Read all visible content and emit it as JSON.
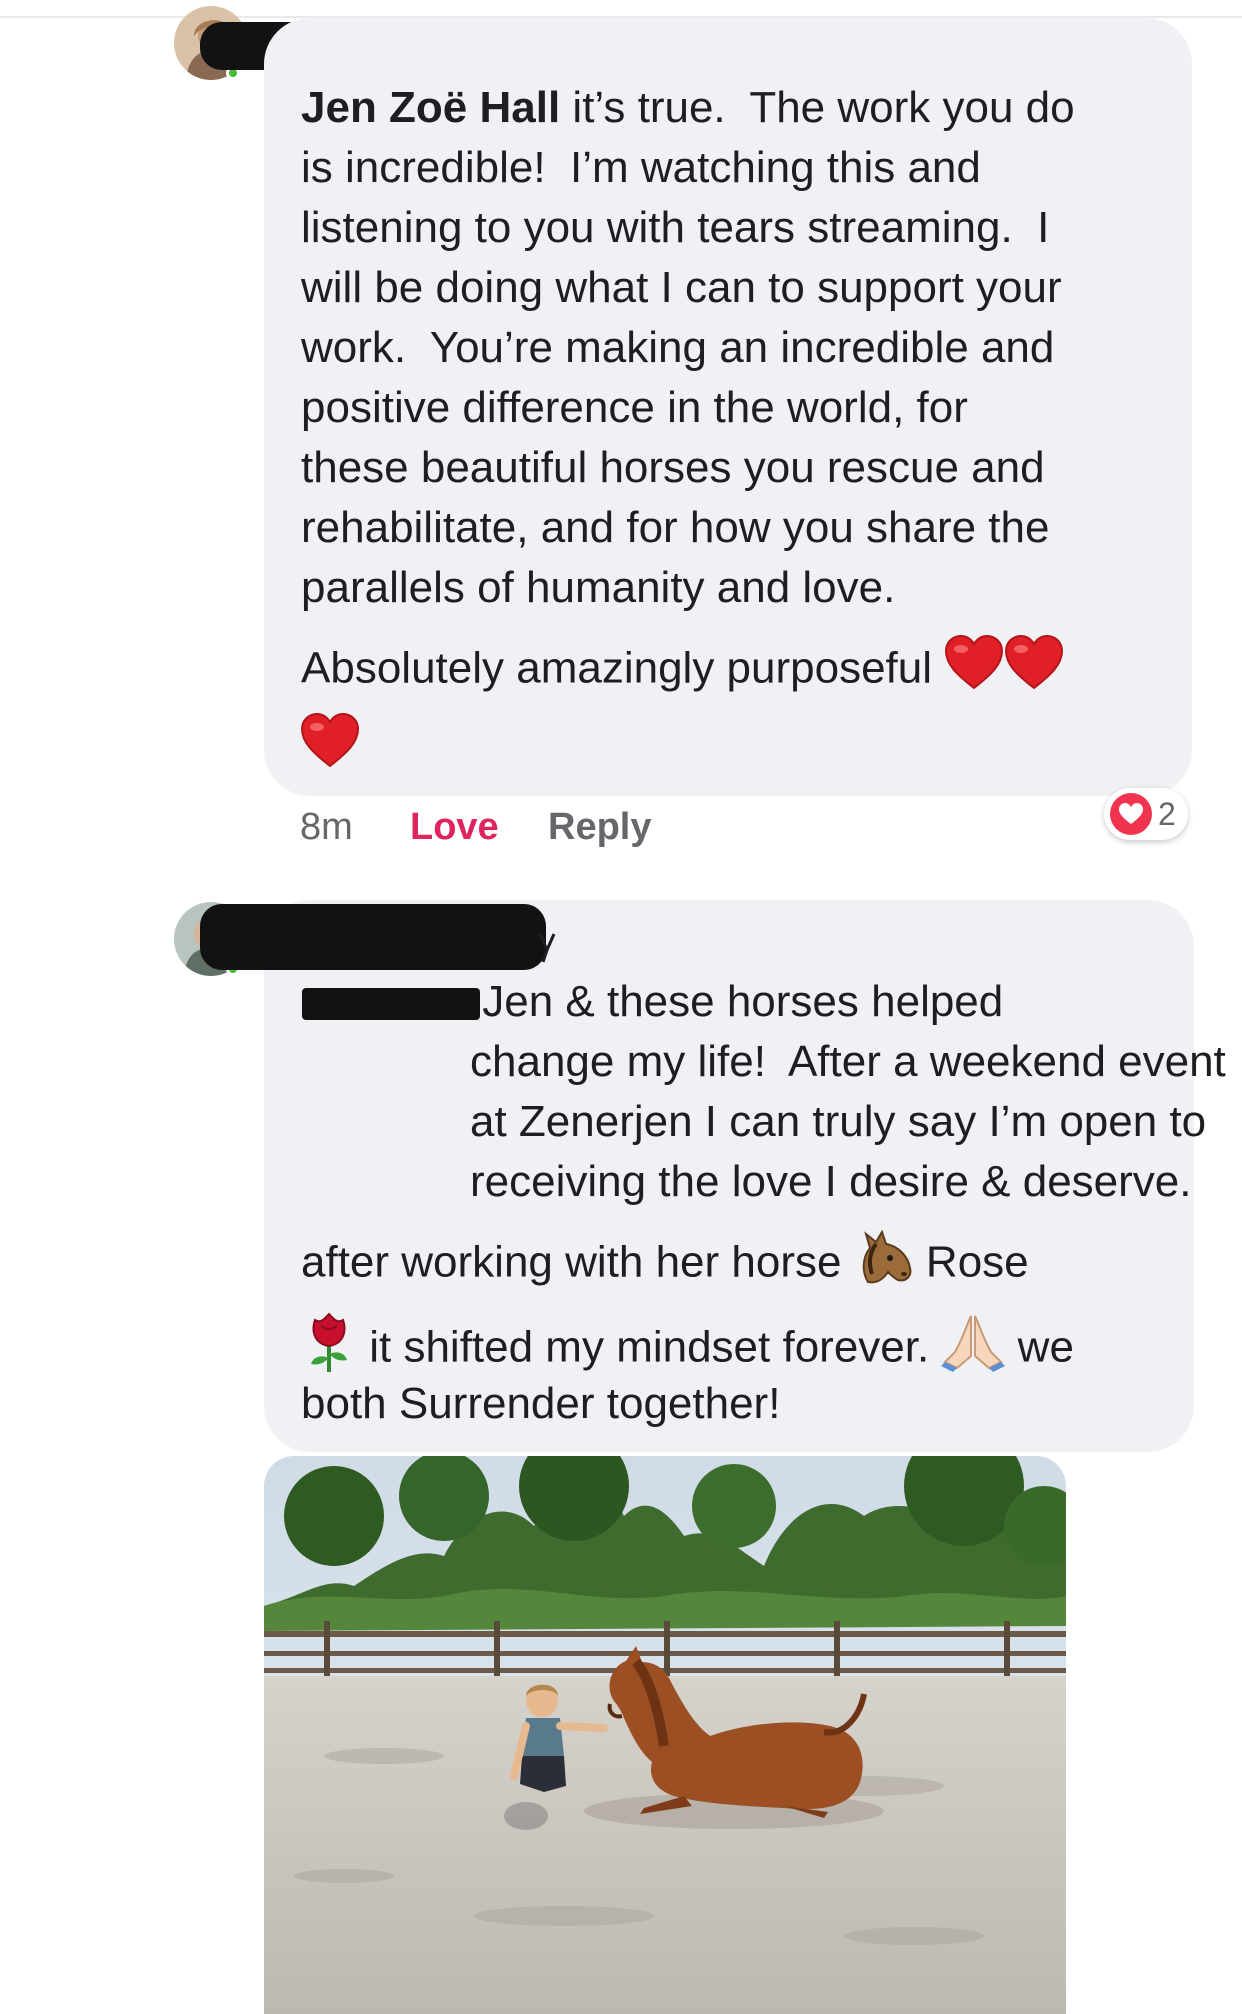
{
  "comments": [
    {
      "author": "Jen Zoë Hall",
      "paragraph1": " it’s true.  The work you do\nis incredible!  I’m watching this and\nlistening to you with tears streaming.  I\nwill be doing what I can to support your\nwork.  You’re making an incredible and\npositive difference in the world, for\nthese beautiful horses you rescue and\nrehabilitate, and for how you share the\nparallels of humanity and love.",
      "paragraph2": "Absolutely amazingly purposeful",
      "emojis": [
        "red-heart",
        "red-heart",
        "red-heart"
      ],
      "time": "8m",
      "love_label": "Love",
      "reply_label": "Reply",
      "reaction_count": "2"
    },
    {
      "paragraph1": " Jen & these horses helped\nchange my life!  After a weekend event\nat Zenerjen I can truly say I’m open to\nreceiving the love I desire & deserve.",
      "line_horse_before": "after working with her horse ",
      "line_horse_after": " Rose",
      "line_rose_after": " it shifted my mindset forever. ",
      "line_pray_after": " we",
      "line_last": "both Surrender together!",
      "emojis": [
        "horse-face",
        "rose",
        "folded-hands"
      ]
    }
  ],
  "colors": {
    "bubble": "#f0f1f4",
    "love": "#e0245e",
    "meta": "#65676b",
    "heart": "#f0344f"
  }
}
